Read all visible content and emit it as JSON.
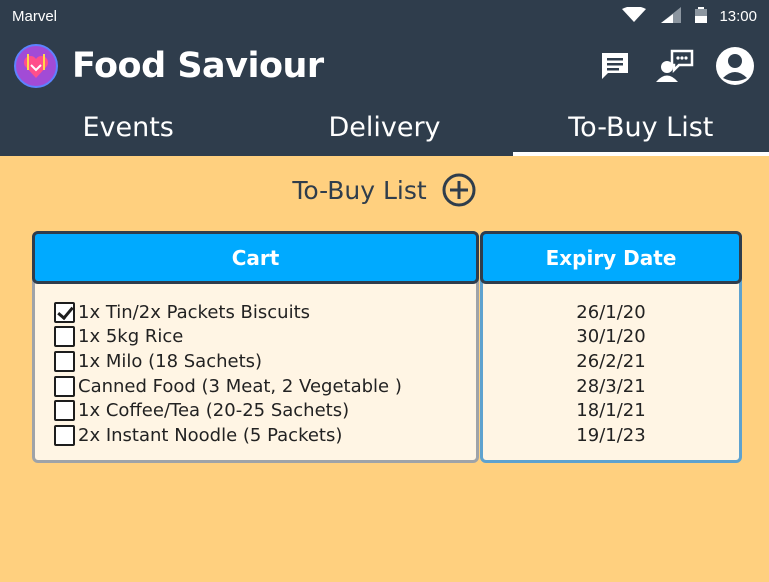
{
  "status_bar": {
    "carrier": "Marvel",
    "time": "13:00",
    "icons": [
      "wifi-icon",
      "signal-icon",
      "battery-icon"
    ]
  },
  "app_bar": {
    "title": "Food Saviour",
    "logo_icon": "food-saviour-logo",
    "actions": [
      "chat-icon",
      "contacts-chat-icon",
      "account-icon"
    ]
  },
  "tabs": [
    {
      "label": "Events",
      "active": false
    },
    {
      "label": "Delivery",
      "active": false
    },
    {
      "label": "To-Buy List",
      "active": true
    }
  ],
  "main": {
    "title": "To-Buy List",
    "add_icon": "add-circle-icon",
    "cart_header": "Cart",
    "expiry_header": "Expiry Date",
    "items": [
      {
        "label": "1x Tin/2x Packets Biscuits",
        "checked": true,
        "expiry": "26/1/20"
      },
      {
        "label": "1x 5kg Rice",
        "checked": false,
        "expiry": "30/1/20"
      },
      {
        "label": "1x Milo (18 Sachets)",
        "checked": false,
        "expiry": "26/2/21"
      },
      {
        "label": "Canned Food (3 Meat, 2 Vegetable )",
        "checked": false,
        "expiry": "28/3/21"
      },
      {
        "label": "1x Coffee/Tea (20-25 Sachets)",
        "checked": false,
        "expiry": "18/1/21"
      },
      {
        "label": "2x Instant Noodle (5 Packets)",
        "checked": false,
        "expiry": "19/1/23"
      }
    ]
  },
  "colors": {
    "app_bar": "#2f3d4c",
    "content_bg": "#ffd07f",
    "panel_header": "#00aaff",
    "panel_bg": "#fff5e4"
  }
}
